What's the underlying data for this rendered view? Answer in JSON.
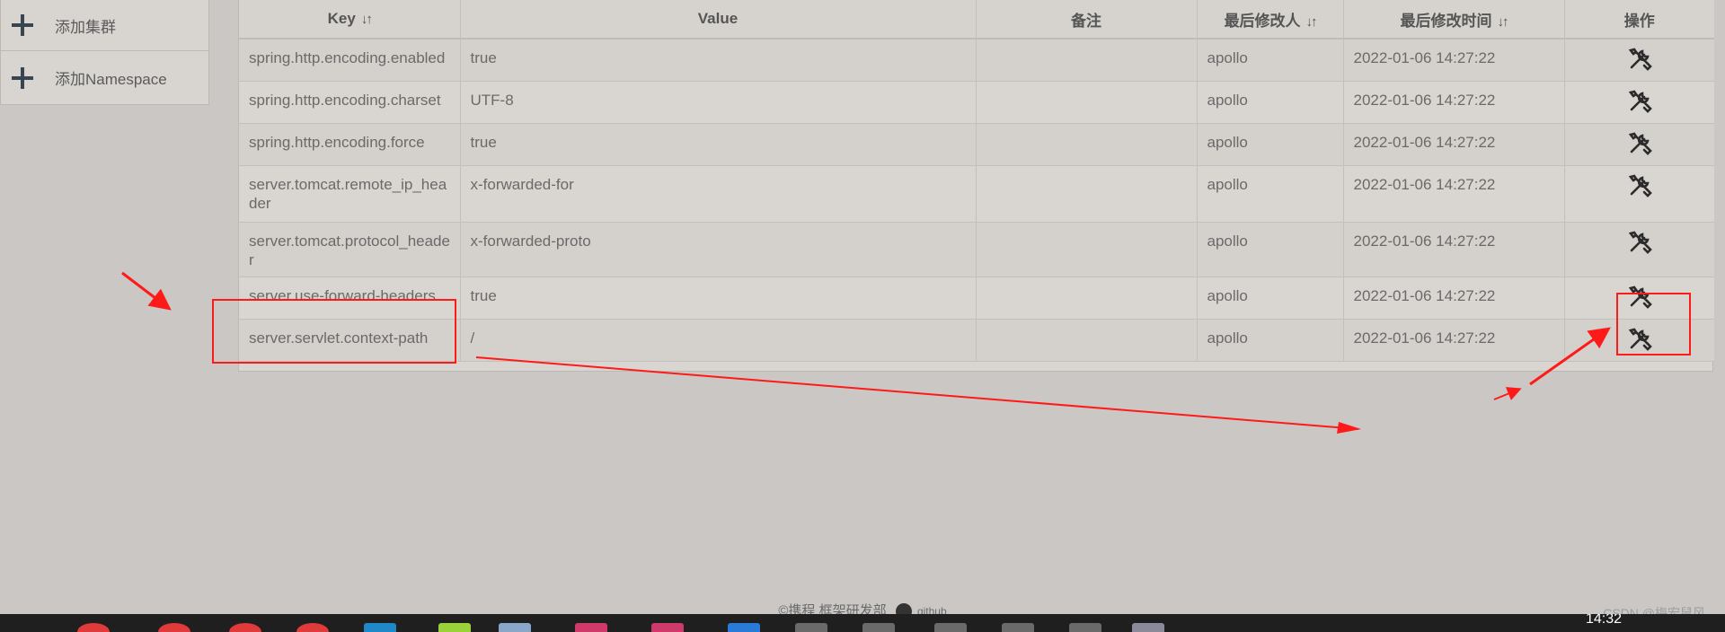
{
  "sidebar": {
    "items": [
      {
        "label": "添加集群",
        "icon": "plus-icon"
      },
      {
        "label": "添加Namespace",
        "icon": "plus-icon"
      }
    ]
  },
  "table": {
    "headers": {
      "key": "Key",
      "value": "Value",
      "comment": "备注",
      "modifier": "最后修改人",
      "modified_time": "最后修改时间",
      "action": "操作"
    },
    "sort_icon": "sort-arrows-icon",
    "rows": [
      {
        "key": "spring.http.encoding.enabled",
        "value": "true",
        "comment": "",
        "modifier": "apollo",
        "time": "2022-01-06 14:27:22"
      },
      {
        "key": "spring.http.encoding.charset",
        "value": "UTF-8",
        "comment": "",
        "modifier": "apollo",
        "time": "2022-01-06 14:27:22"
      },
      {
        "key": "spring.http.encoding.force",
        "value": "true",
        "comment": "",
        "modifier": "apollo",
        "time": "2022-01-06 14:27:22"
      },
      {
        "key": "server.tomcat.remote_ip_header",
        "value": "x-forwarded-for",
        "comment": "",
        "modifier": "apollo",
        "time": "2022-01-06 14:27:22"
      },
      {
        "key": "server.tomcat.protocol_header",
        "value": "x-forwarded-proto",
        "comment": "",
        "modifier": "apollo",
        "time": "2022-01-06 14:27:22"
      },
      {
        "key": "server.use-forward-headers",
        "value": "true",
        "comment": "",
        "modifier": "apollo",
        "time": "2022-01-06 14:27:22"
      },
      {
        "key": "server.servlet.context-path",
        "value": "/",
        "comment": "",
        "modifier": "apollo",
        "time": "2022-01-06 14:27:22"
      }
    ]
  },
  "footer": {
    "text": "©携程 框架研发部",
    "github": "github"
  },
  "taskbar": {
    "clock": "14:32"
  },
  "watermark": "CSDN @梅宏鼠风",
  "colors": {
    "annotation": "#ff1a1a",
    "background": "#cbc7c4"
  }
}
